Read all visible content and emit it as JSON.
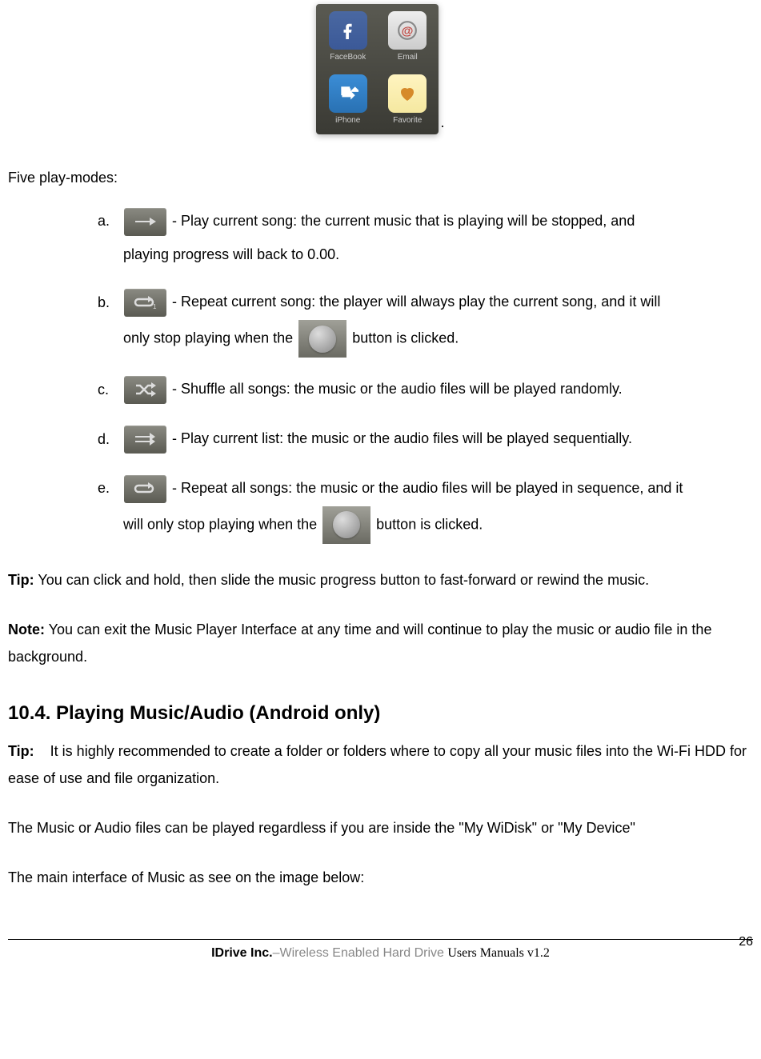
{
  "share_panel": {
    "items": [
      {
        "label": "FaceBook"
      },
      {
        "label": "Email"
      },
      {
        "label": "iPhone"
      },
      {
        "label": "Favorite"
      }
    ],
    "after": "."
  },
  "intro": "Five play-modes:",
  "list": {
    "a": {
      "label": "a.",
      "text1": "- Play current song: the current music that is playing will be stopped, and",
      "text2": "playing progress will back to 0.00."
    },
    "b": {
      "label": "b.",
      "text1": "- Repeat current song: the player will always play the current song, and it will",
      "text2a": "only stop playing when the",
      "text2b": "button is clicked."
    },
    "c": {
      "label": "c.",
      "text1": "- Shuffle all songs: the music or the audio files will be played randomly."
    },
    "d": {
      "label": "d.",
      "text1": "- Play current list: the music or the audio files will be played sequentially."
    },
    "e": {
      "label": "e.",
      "text1": "- Repeat all songs: the music or the audio files will be played in sequence, and it",
      "text2a": "will only stop playing when the ",
      "text2b": "button is clicked."
    }
  },
  "tip1": {
    "label": "Tip:",
    "text": " You can click and hold, then slide the music progress button to fast-forward or rewind the music."
  },
  "note1": {
    "label": "Note:",
    "text": " You can exit the Music Player Interface at any time and will continue to play the music or audio file in the background."
  },
  "heading": "10.4. Playing Music/Audio (Android only)",
  "tip2": {
    "label": "Tip:",
    "text": "    It is highly recommended to create a folder or folders where to copy all your music files into the Wi-Fi HDD for ease of use and file organization."
  },
  "para2": "The Music or Audio files can be played regardless if you are inside the \"My WiDisk\" or \"My Device\"",
  "para3": "The main interface of Music as see on the image below:",
  "footer": {
    "brand": "IDrive Inc.",
    "grey": "–Wireless Enabled Hard Drive    ",
    "serif": "Users Manuals v1.2",
    "page": "26"
  }
}
